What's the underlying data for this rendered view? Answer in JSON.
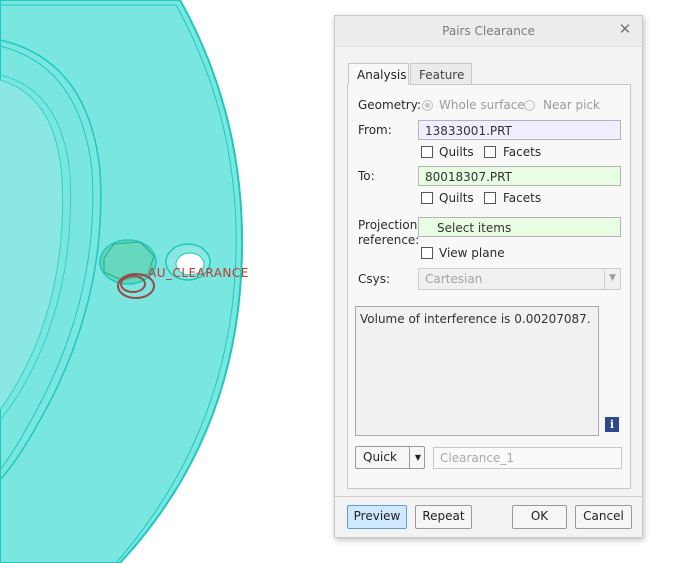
{
  "viewport": {
    "annotation": "AU_CLEARANCE",
    "model_color": "#7ae6e0",
    "edge_color": "#1ec8c0"
  },
  "dialog": {
    "title": "Pairs Clearance",
    "close_icon": "close-icon",
    "tabs": [
      {
        "label": "Analysis",
        "active": true
      },
      {
        "label": "Feature",
        "active": false
      }
    ],
    "geometry": {
      "label": "Geometry:",
      "options": [
        "Whole surface",
        "Near pick"
      ],
      "selected": "Whole surface"
    },
    "from": {
      "label": "From:",
      "value": "13833001.PRT",
      "quilts_label": "Quilts",
      "facets_label": "Facets"
    },
    "to": {
      "label": "To:",
      "value": "80018307.PRT",
      "quilts_label": "Quilts",
      "facets_label": "Facets"
    },
    "projection": {
      "label_line1": "Projection",
      "label_line2": "reference:",
      "value": "Select items",
      "view_plane_label": "View plane"
    },
    "csys": {
      "label": "Csys:",
      "value": "Cartesian"
    },
    "result_text": "Volume of interference is 0.00207087.",
    "info_icon": "info-icon",
    "quick": {
      "label": "Quick",
      "name_placeholder": "Clearance_1"
    },
    "buttons": {
      "preview": "Preview",
      "repeat": "Repeat",
      "ok": "OK",
      "cancel": "Cancel"
    }
  }
}
